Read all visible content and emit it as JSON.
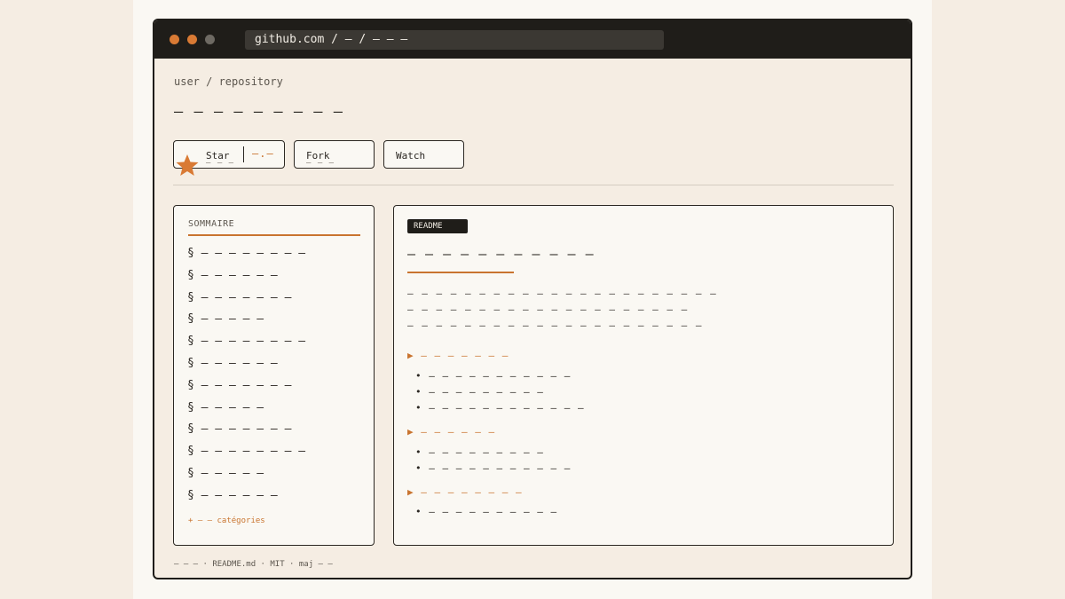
{
  "browser": {
    "url": "github.com / — / — — —"
  },
  "repo": {
    "breadcrumb": "user / repository",
    "title": "— — — — — — — — —"
  },
  "actions": {
    "star_label": "Star",
    "star_count": "— — —",
    "connector": "—.—",
    "fork_label": "Fork",
    "fork_count": "— — —",
    "watch_label": "Watch"
  },
  "sidebar": {
    "heading": "SOMMAIRE",
    "items": [
      {
        "label": "§ — — — — — — — —"
      },
      {
        "label": "§ — — — — — —"
      },
      {
        "label": "§ — — — — — — —"
      },
      {
        "label": "§ — — — — —"
      },
      {
        "label": "§ — — — — — — — —"
      },
      {
        "label": "§ — — — — — —"
      },
      {
        "label": "§ — — — — — — —"
      },
      {
        "label": "§ — — — — —"
      },
      {
        "label": "§ — — — — — — —"
      },
      {
        "label": "§ — — — — — — — —"
      },
      {
        "label": "§ — — — — —"
      },
      {
        "label": "§ — — — — — —"
      }
    ],
    "more": "+ — — catégories"
  },
  "readme": {
    "badge": "README",
    "title": "— — — — — — — — — — —",
    "paragraph": [
      "— — — — — — — — — — — — — — — — — — — — — —",
      "— — — — — — — — — — — — — — — — — — — —",
      "— — — — — — — — — — — — — — — — — — — — —"
    ],
    "sections": [
      {
        "heading": "▶ — — — — — — —",
        "bullets": [
          "• — — — — — — — — — — —",
          "• — — — — — — — — —",
          "• — — — — — — — — — — — —"
        ]
      },
      {
        "heading": "▶ — — — — — —",
        "bullets": [
          "• — — — — — — — — —",
          "• — — — — — — — — — — —"
        ]
      },
      {
        "heading": "▶ — — — — — — — —",
        "bullets": [
          "• — — — — — — — — — —"
        ]
      }
    ]
  },
  "footer": {
    "text": "— — — · README.md · MIT · maj — —"
  },
  "colors": {
    "accent": "#c9742f",
    "titlebar": "#1f1d19",
    "background": "#f5ede3",
    "panel": "#faf8f3"
  }
}
